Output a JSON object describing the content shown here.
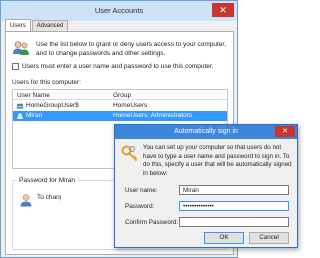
{
  "user_accounts": {
    "title": "User Accounts",
    "close_glyph": "✕",
    "tabs": [
      {
        "label": "Users",
        "active": true
      },
      {
        "label": "Advanced",
        "active": false
      }
    ],
    "intro": "Use the list below to grant or deny users access to your computer, and to change passwords and other settings.",
    "intro_icon": "users-icon",
    "must_enter_label": "Users must enter a user name and password to use this computer.",
    "must_enter_checked": false,
    "users_label": "Users for this computer:",
    "columns": {
      "user_name": "User Name",
      "group": "Group"
    },
    "users": [
      {
        "name": "HomeGroupUser$",
        "group": "HomeUsers",
        "selected": false
      },
      {
        "name": "Miran",
        "group": "HomeUsers; Administrators",
        "selected": true
      }
    ],
    "password_group_label": "Password for Miran",
    "password_text": "To change"
  },
  "auto_sign_in": {
    "title": "Automatically sign in",
    "close_glyph": "✕",
    "icon": "keys-icon",
    "description": "You can set up your computer so that users do not have to type a user name and password to sign in. To do this, specify a user that will be automatically signed in below:",
    "user_name_label": "User name:",
    "user_name_value": "Miran",
    "password_label": "Password:",
    "password_value": "••••••••••••••",
    "confirm_label": "Confirm Password:",
    "confirm_value": "",
    "ok_label": "OK",
    "cancel_label": "Cancel"
  },
  "colors": {
    "selection": "#3399ff",
    "dialog_title": "#3c87d9",
    "close_button": "#c7372f"
  }
}
